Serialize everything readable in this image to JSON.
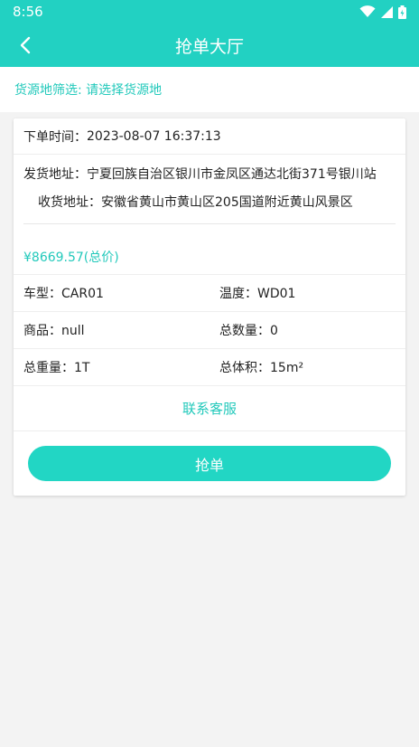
{
  "status_bar": {
    "time": "8:56"
  },
  "app_bar": {
    "title": "抢单大厅"
  },
  "filter": {
    "label": "货源地筛选: ",
    "value": "请选择货源地"
  },
  "order": {
    "time_label": "下单时间：",
    "time_value": "2023-08-07 16:37:13",
    "ship_label": "发货地址：",
    "ship_value": "宁夏回族自治区银川市金凤区通达北街371号银川站",
    "recv_label": "收货地址：",
    "recv_value": "安徽省黄山市黄山区205国道附近黄山风景区",
    "price": "¥8669.57(总价)",
    "vehicle_label": "车型：",
    "vehicle_value": "CAR01",
    "temp_label": "温度：",
    "temp_value": "WD01",
    "goods_label": "商品：",
    "goods_value": "null",
    "qty_label": "总数量：",
    "qty_value": "0",
    "weight_label": "总重量：",
    "weight_value": "1T",
    "volume_label": "总体积：",
    "volume_value": "15m²",
    "contact_label": "联系客服",
    "grab_label": "抢单"
  },
  "colors": {
    "accent": "#22d1c2",
    "background": "#f3f3f3"
  },
  "icons": [
    "wifi-icon",
    "signal-icon",
    "battery-icon",
    "back-arrow-icon"
  ]
}
